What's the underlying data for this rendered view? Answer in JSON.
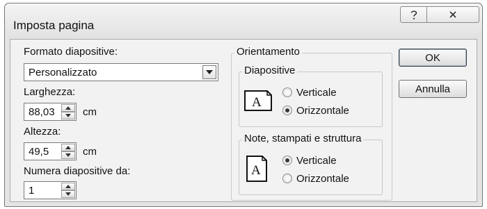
{
  "window": {
    "title": "Imposta pagina"
  },
  "titlebar": {
    "help_icon": "question-mark-icon",
    "close_icon": "close-x-icon"
  },
  "slide_size": {
    "label": "Formato diapositive:",
    "selected": "Personalizzato"
  },
  "width": {
    "label": "Larghezza:",
    "value": "88,03",
    "unit": "cm"
  },
  "height": {
    "label": "Altezza:",
    "value": "49,5",
    "unit": "cm"
  },
  "number_from": {
    "label": "Numera diapositive da:",
    "value": "1"
  },
  "orientation": {
    "title": "Orientamento",
    "slides": {
      "title": "Diapositive",
      "options": [
        "Verticale",
        "Orizzontale"
      ],
      "selected": "Orizzontale"
    },
    "notes": {
      "title": "Note, stampati e struttura",
      "options": [
        "Verticale",
        "Orizzontale"
      ],
      "selected": "Verticale"
    }
  },
  "buttons": {
    "ok": "OK",
    "cancel": "Annulla"
  }
}
